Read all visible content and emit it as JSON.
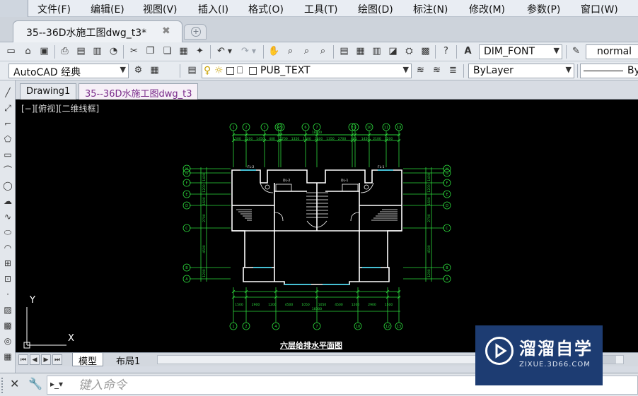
{
  "menu": {
    "items": [
      "文件(F)",
      "编辑(E)",
      "视图(V)",
      "插入(I)",
      "格式(O)",
      "工具(T)",
      "绘图(D)",
      "标注(N)",
      "修改(M)",
      "参数(P)",
      "窗口(W)"
    ]
  },
  "doc_tab": {
    "label": "35--36D水施工图dwg_t3*",
    "close": "✖"
  },
  "toolbar1": {
    "text_style": "DIM_FONT",
    "dim_style": "normal"
  },
  "toolbar2": {
    "workspace": "AutoCAD 经典",
    "layer": "PUB_TEXT",
    "color": "ByLayer",
    "linetype": "By"
  },
  "drawing_tabs": [
    "Drawing1",
    "35--36D水施工图dwg_t3"
  ],
  "canvas": {
    "viewport_label": "[−][俯视][二维线框]",
    "drawing_title": "六层给排水平面图",
    "ucs_x": "X",
    "ucs_y": "Y",
    "dims_top": [
      "1500",
      "2100",
      "1450",
      "400",
      "2700",
      "1350",
      "1500",
      "2400",
      "1350",
      "2700",
      "400",
      "1450",
      "2100",
      "1500"
    ],
    "dims_top_total": "18300",
    "dims_bottom": [
      "1500",
      "2900",
      "1200",
      "4500",
      "1050",
      "1050",
      "4500",
      "1200",
      "2900",
      "1500"
    ],
    "dims_bottom_total": "18300",
    "dims_side": [
      "1400",
      "1200",
      "1600",
      "2700",
      "4500",
      "1200"
    ],
    "room_labels": [
      "FL-2",
      "FL-1",
      "DL-2",
      "DL-1"
    ],
    "axis_top": [
      "1",
      "2",
      "3",
      "4",
      "5",
      "6",
      "7",
      "8",
      "9",
      "10",
      "11",
      "12",
      "13"
    ],
    "axis_bottom": [
      "1",
      "2",
      "4",
      "7",
      "10",
      "12",
      "13"
    ],
    "axis_side": [
      "H",
      "G",
      "F",
      "E",
      "D",
      "C",
      "B",
      "A"
    ]
  },
  "layout_tabs": [
    "模型",
    "布局1"
  ],
  "command": {
    "placeholder": "键入命令"
  },
  "watermark": {
    "title": "溜溜自学",
    "subtitle": "ZIXUE.3D66.COM"
  },
  "colors": {
    "canvas_bg": "#000000",
    "dim_green": "#2cd83c",
    "wall_white": "#ffffff",
    "window_cyan": "#33d6f0"
  }
}
